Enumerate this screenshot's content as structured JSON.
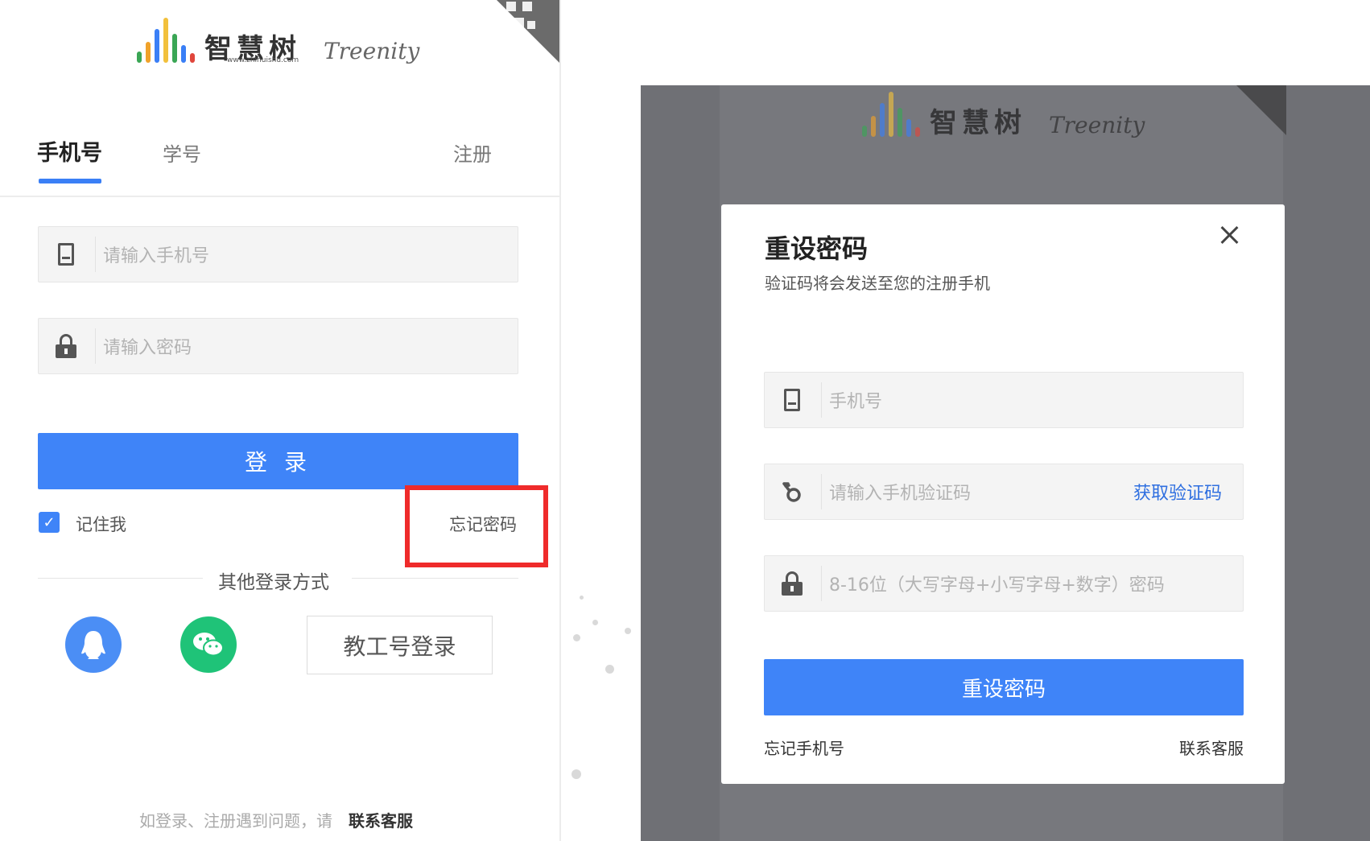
{
  "login": {
    "logo_cn": "智慧树",
    "logo_url": "www.zhihuishu.com",
    "logo_en": "Treenity",
    "tabs": [
      "手机号",
      "学号"
    ],
    "register_link": "注册",
    "phone_placeholder": "请输入手机号",
    "password_placeholder": "请输入密码",
    "login_button": "登 录",
    "remember_me": "记住我",
    "forgot_password": "忘记密码",
    "other_login_label": "其他登录方式",
    "staff_login_button": "教工号登录",
    "footer_text": "如登录、注册遇到问题，请",
    "footer_link": "联系客服"
  },
  "reset": {
    "title": "重设密码",
    "subtitle": "验证码将会发送至您的注册手机",
    "phone_placeholder": "手机号",
    "code_placeholder": "请输入手机验证码",
    "get_code": "获取验证码",
    "password_placeholder": "8-16位（大写字母+小写字母+数字）密码",
    "submit_button": "重设密码",
    "forgot_phone": "忘记手机号",
    "contact_support": "联系客服"
  },
  "colors": {
    "primary": "#3f84f8",
    "highlight": "#ef2b2b",
    "qq": "#4b8ef5",
    "wechat": "#1fc378",
    "overlay": "#6f7075"
  },
  "icons": [
    "phone-icon",
    "lock-icon",
    "key-icon",
    "qq-icon",
    "wechat-icon",
    "close-icon",
    "check-icon",
    "qr-code-icon"
  ]
}
